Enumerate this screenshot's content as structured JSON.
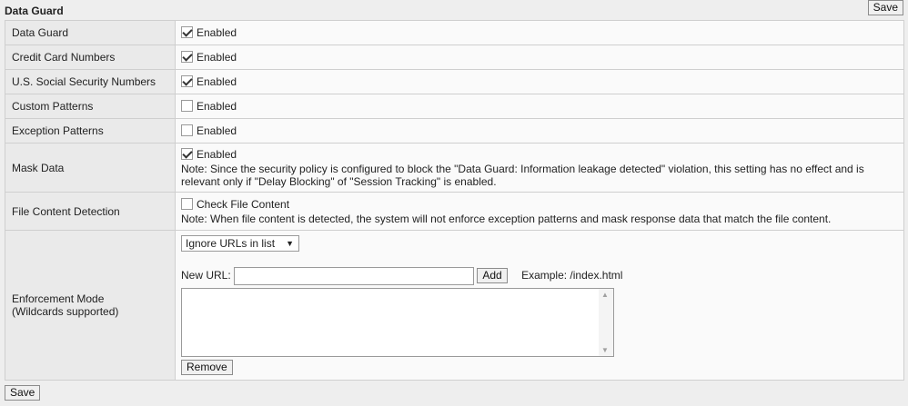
{
  "header": {
    "title": "Data Guard",
    "save_label": "Save"
  },
  "rows": {
    "data_guard": {
      "label": "Data Guard",
      "option": "Enabled",
      "checked": true
    },
    "credit_cards": {
      "label": "Credit Card Numbers",
      "option": "Enabled",
      "checked": true
    },
    "ssn": {
      "label": "U.S. Social Security Numbers",
      "option": "Enabled",
      "checked": true
    },
    "custom_patterns": {
      "label": "Custom Patterns",
      "option": "Enabled",
      "checked": false
    },
    "exception_patterns": {
      "label": "Exception Patterns",
      "option": "Enabled",
      "checked": false
    },
    "mask_data": {
      "label": "Mask Data",
      "option": "Enabled",
      "checked": true,
      "note": "Note: Since the security policy is configured to block the \"Data Guard: Information leakage detected\" violation, this setting has no effect and is relevant only if \"Delay Blocking\" of \"Session Tracking\" is enabled."
    },
    "file_content": {
      "label": "File Content Detection",
      "option": "Check File Content",
      "checked": false,
      "note": "Note: When file content is detected, the system will not enforce exception patterns and mask response data that match the file content."
    },
    "enforcement": {
      "label": "Enforcement Mode",
      "sublabel": "(Wildcards supported)",
      "select_value": "Ignore URLs in list",
      "new_url_label": "New URL:",
      "new_url_value": "",
      "add_label": "Add",
      "example": "Example: /index.html",
      "remove_label": "Remove"
    }
  },
  "footer": {
    "save_label": "Save"
  }
}
